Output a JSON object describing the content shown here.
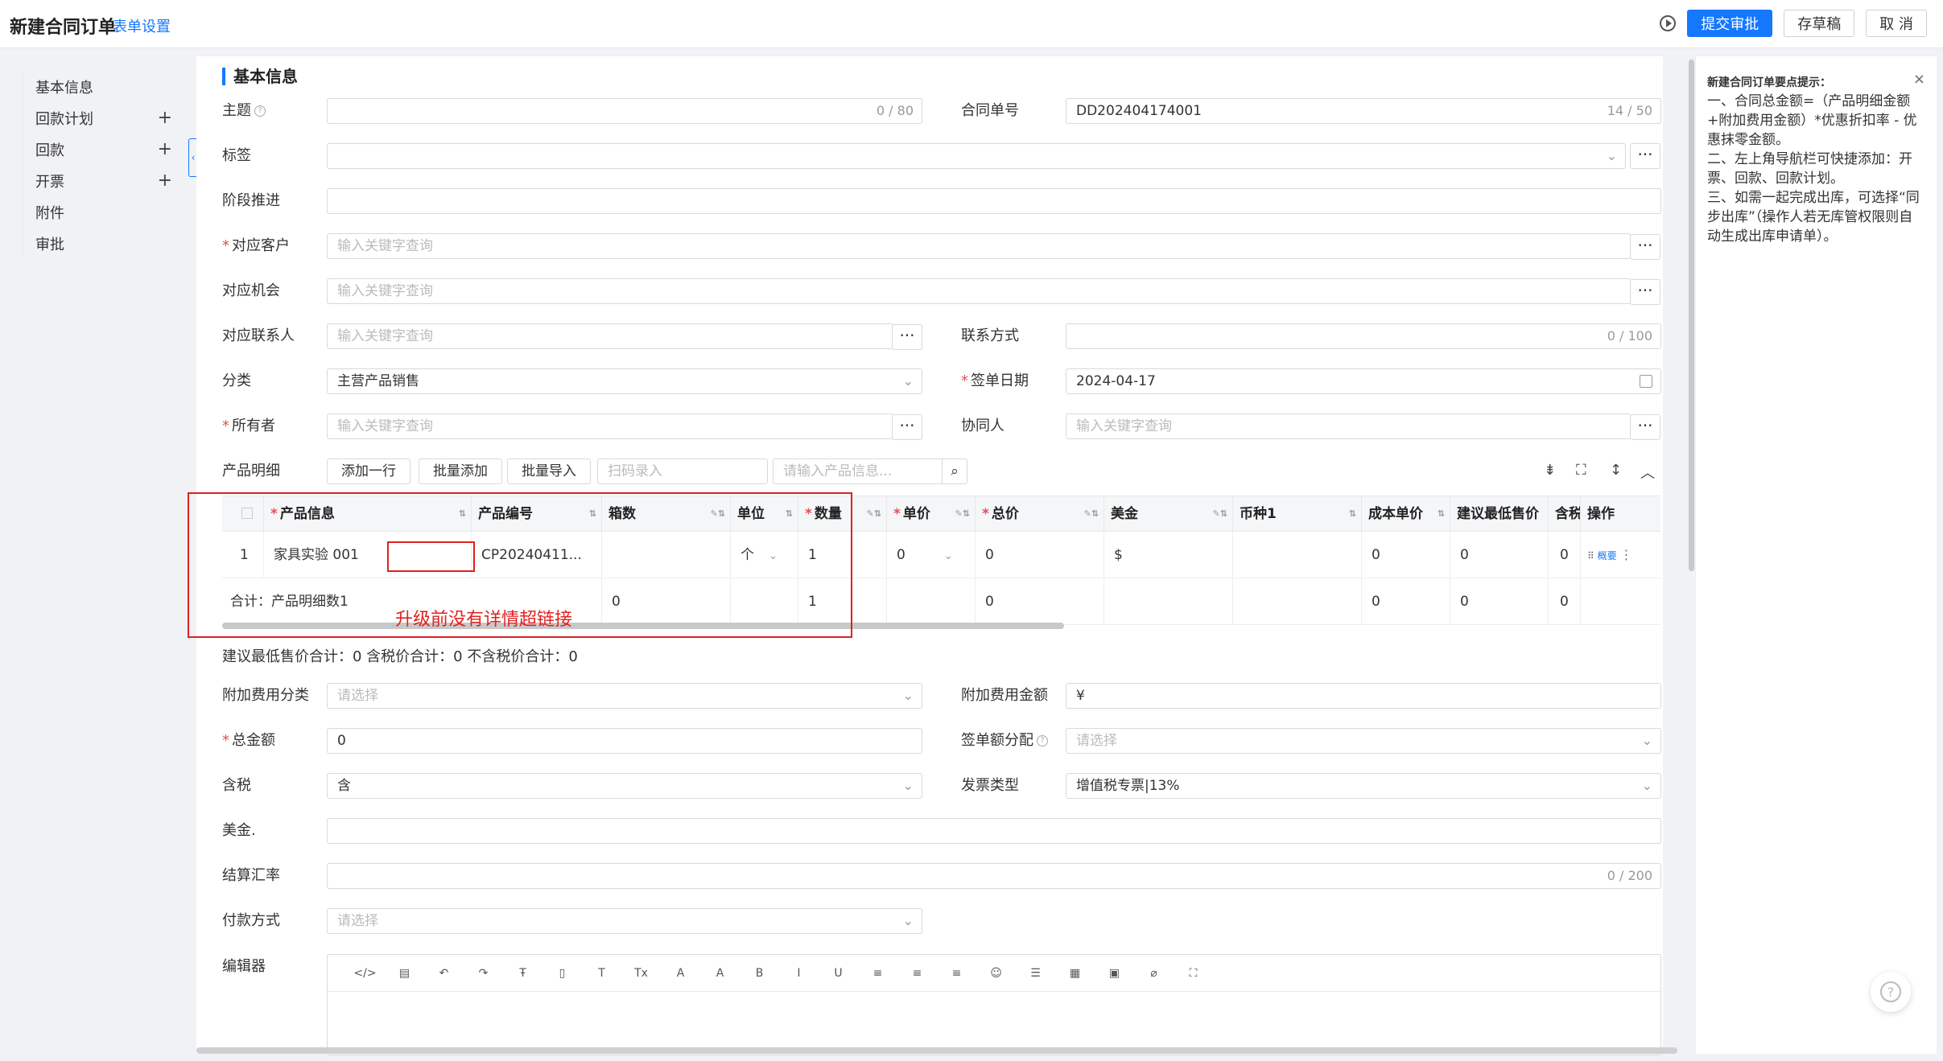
{
  "header": {
    "title": "新建合同订单",
    "form_settings": "表单设置",
    "submit": "提交审批",
    "save_draft": "存草稿",
    "cancel": "取 消"
  },
  "nav": {
    "items": [
      {
        "label": "基本信息",
        "plus": false
      },
      {
        "label": "回款计划",
        "plus": true
      },
      {
        "label": "回款",
        "plus": true
      },
      {
        "label": "开票",
        "plus": true
      },
      {
        "label": "附件",
        "plus": false
      },
      {
        "label": "审批",
        "plus": false
      }
    ],
    "plus_glyph": "+"
  },
  "section": {
    "title": "基本信息"
  },
  "fields": {
    "subject": {
      "label": "主题",
      "counter": "0 / 80"
    },
    "contract_no": {
      "label": "合同单号",
      "value": "DD202404174001",
      "counter": "14 / 50"
    },
    "tags": {
      "label": "标签"
    },
    "stage": {
      "label": "阶段推进"
    },
    "customer": {
      "label": "对应客户",
      "placeholder": "输入关键字查询"
    },
    "opportunity": {
      "label": "对应机会",
      "placeholder": "输入关键字查询"
    },
    "contact": {
      "label": "对应联系人",
      "placeholder": "输入关键字查询"
    },
    "contact_method": {
      "label": "联系方式",
      "counter": "0 / 100"
    },
    "category": {
      "label": "分类",
      "value": "主营产品销售"
    },
    "sign_date": {
      "label": "签单日期",
      "value": "2024-04-17"
    },
    "owner": {
      "label": "所有者",
      "placeholder": "输入关键字查询"
    },
    "collaborator": {
      "label": "协同人",
      "placeholder": "输入关键字查询"
    },
    "products": {
      "label": "产品明细"
    }
  },
  "product_toolbar": {
    "add_row": "添加一行",
    "batch_add": "批量添加",
    "batch_import": "批量导入",
    "scan_placeholder": "扫码录入",
    "search_placeholder": "请输入产品信息..."
  },
  "table": {
    "headers": [
      "产品信息",
      "产品编号",
      "箱数",
      "单位",
      "数量",
      "单价",
      "总价",
      "美金",
      "币种1",
      "成本单价",
      "建议最低售价",
      "含税",
      "操作"
    ],
    "row": {
      "index": "1",
      "product": "家具实验 001",
      "code": "CP20240411...",
      "box": "",
      "unit": "个",
      "qty": "1",
      "price": "0",
      "total": "0",
      "usd": "$",
      "currency": "",
      "cost": "0",
      "min_price": "0",
      "tax": "0",
      "action": "概要"
    },
    "sum_row": {
      "label": "合计：产品明细数1",
      "box": "0",
      "qty": "1",
      "total": "0",
      "cost": "0",
      "min_price": "0",
      "tax": "0"
    }
  },
  "annotation": {
    "text": "升级前没有详情超链接"
  },
  "totals_line": "建议最低售价合计：0 含税价合计：0 不含税价合计：0",
  "fields2": {
    "extra_fee_type": {
      "label": "附加费用分类",
      "placeholder": "请选择"
    },
    "extra_fee_amount": {
      "label": "附加费用金额",
      "value": "¥"
    },
    "total_amount": {
      "label": "总金额",
      "value": "0"
    },
    "sign_allocation": {
      "label": "签单额分配",
      "placeholder": "请选择"
    },
    "tax": {
      "label": "含税",
      "value": "含"
    },
    "invoice_type": {
      "label": "发票类型",
      "value": "增值税专票|13%"
    },
    "usd": {
      "label": "美金."
    },
    "exchange_rate": {
      "label": "结算汇率",
      "counter": "0 / 200"
    },
    "payment_method": {
      "label": "付款方式",
      "placeholder": "请选择"
    },
    "editor": {
      "label": "编辑器"
    }
  },
  "editor_tools": [
    "</>",
    "▤",
    "↶",
    "↷",
    "Ŧ",
    "▯",
    "T",
    "Tx",
    "A",
    "A",
    "B",
    "I",
    "U",
    "≡",
    "≡",
    "≡",
    "☺",
    "☰",
    "▦",
    "▣",
    "⌀",
    "⛶"
  ],
  "tips": {
    "title": "新建合同订单要点提示：",
    "body": "一、合同总金额=（产品明细金额+附加费用金额）*优惠折扣率 - 优惠抹零金额。\n二、左上角导航栏可快捷添加：开票、回款、回款计划。\n三、如需一起完成出库，可选择“同步出库”（操作人若无库管权限则自动生成出库申请单）。"
  }
}
